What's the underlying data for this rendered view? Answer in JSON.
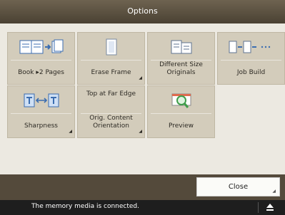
{
  "title": "Options",
  "buttons": [
    {
      "label": "Book ▸2 Pages",
      "icon": "book-to-two-pages-icon",
      "has_menu": false
    },
    {
      "label": "Erase Frame",
      "icon": "erase-frame-icon",
      "has_menu": true
    },
    {
      "label": "Different Size Originals",
      "icon": "different-size-originals-icon",
      "has_menu": false
    },
    {
      "label": "Job Build",
      "icon": "job-build-icon",
      "has_menu": false
    },
    {
      "label": "Sharpness",
      "icon": "sharpness-icon",
      "has_menu": true
    },
    {
      "top_label": "Top at Far Edge",
      "label": "Orig. Content Orientation",
      "has_menu": true
    },
    {
      "label": "Preview",
      "icon": "preview-icon",
      "has_menu": false
    }
  ],
  "close_label": "Close",
  "status_message": "The memory media is connected.",
  "colors": {
    "title_bar": "#5a5040",
    "button": "#d3ccbb",
    "accent_blue": "#4a7fc4",
    "accent_green": "#3f9d4a"
  }
}
